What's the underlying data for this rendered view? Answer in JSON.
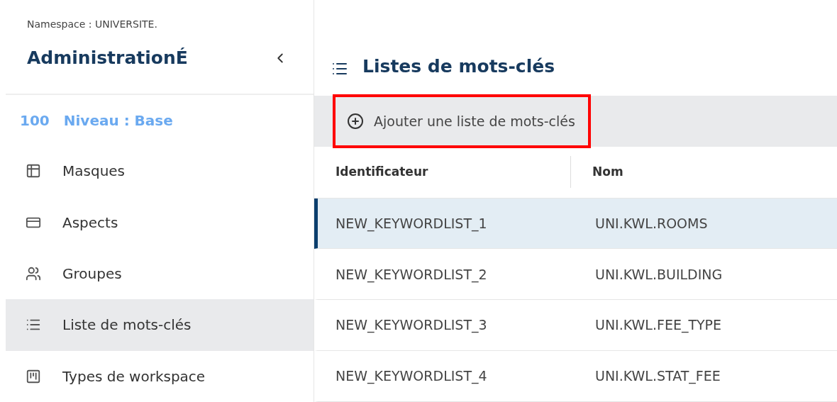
{
  "sidebar": {
    "namespace": "Namespace : UNIVERSITE.",
    "title": "AdministrationÉ",
    "level": {
      "number": "100",
      "label": "Niveau : Base"
    },
    "items": [
      {
        "kind": "table",
        "label": "Masques",
        "selected": false
      },
      {
        "kind": "card",
        "label": "Aspects",
        "selected": false
      },
      {
        "kind": "users",
        "label": "Groupes",
        "selected": false
      },
      {
        "kind": "list",
        "label": "Liste de mots-clés",
        "selected": true
      },
      {
        "kind": "workspace",
        "label": "Types de workspace",
        "selected": false
      }
    ]
  },
  "main": {
    "title": "Listes de mots-clés",
    "add_button": {
      "label": "Ajouter une liste de mots-clés",
      "highlighted": true
    },
    "table": {
      "columns": [
        "Identificateur",
        "Nom"
      ],
      "rows": [
        {
          "cells": [
            "NEW_KEYWORDLIST_1",
            "UNI.KWL.ROOMS"
          ],
          "selected": true
        },
        {
          "cells": [
            "NEW_KEYWORDLIST_2",
            "UNI.KWL.BUILDING"
          ],
          "selected": false
        },
        {
          "cells": [
            "NEW_KEYWORDLIST_3",
            "UNI.KWL.FEE_TYPE"
          ],
          "selected": false
        },
        {
          "cells": [
            "NEW_KEYWORDLIST_4",
            "UNI.KWL.STAT_FEE"
          ],
          "selected": false
        }
      ]
    }
  }
}
